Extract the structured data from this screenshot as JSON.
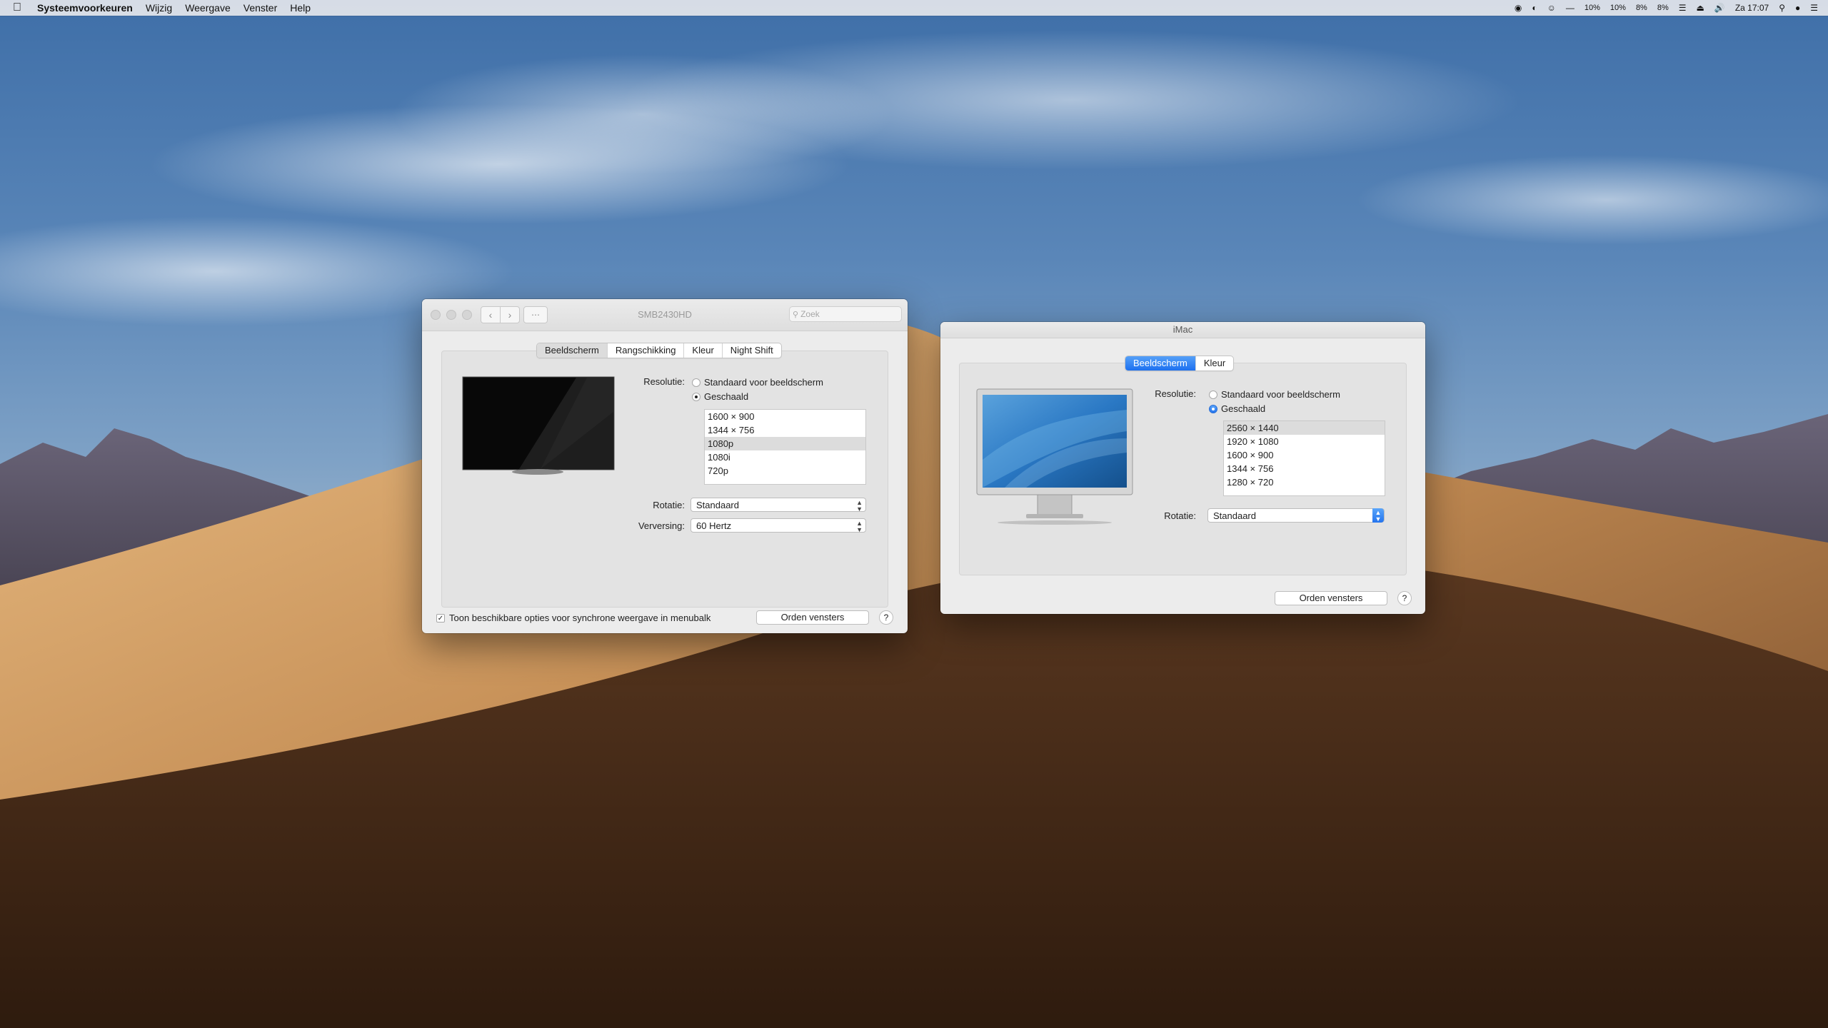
{
  "menubar": {
    "apple_icon": "apple-logo-icon",
    "app_name": "Systeemvoorkeuren",
    "menus": [
      "Wijzig",
      "Weergave",
      "Venster",
      "Help"
    ],
    "status": {
      "stat_1": "10%",
      "stat_2": "10%",
      "stat_3": "8%",
      "stat_4": "8%",
      "clock": "Za 17:07"
    }
  },
  "external_display_window": {
    "title": "SMB2430HD",
    "search_placeholder": "Zoek",
    "tabs": [
      "Beeldscherm",
      "Rangschikking",
      "Kleur",
      "Night Shift"
    ],
    "selected_tab": "Beeldscherm",
    "resolution_label": "Resolutie:",
    "radio_default": "Standaard voor beeldscherm",
    "radio_scaled": "Geschaald",
    "selected_radio": "Geschaald",
    "resolutions": [
      "1600 × 900",
      "1344 × 756",
      "1080p",
      "1080i",
      "720p"
    ],
    "selected_resolution": "1080p",
    "rotation_label": "Rotatie:",
    "rotation_value": "Standaard",
    "refresh_label": "Verversing:",
    "refresh_value": "60 Hertz",
    "mirror_checkbox_label": "Toon beschikbare opties voor synchrone weergave in menubalk",
    "mirror_checked": true,
    "gather_button": "Orden vensters",
    "help_button": "?"
  },
  "imac_window": {
    "title": "iMac",
    "tabs": [
      "Beeldscherm",
      "Kleur"
    ],
    "selected_tab": "Beeldscherm",
    "resolution_label": "Resolutie:",
    "radio_default": "Standaard voor beeldscherm",
    "radio_scaled": "Geschaald",
    "selected_radio": "Geschaald",
    "resolutions": [
      "2560 × 1440",
      "1920 × 1080",
      "1600 × 900",
      "1344 × 756",
      "1280 × 720"
    ],
    "selected_resolution": "2560 × 1440",
    "rotation_label": "Rotatie:",
    "rotation_value": "Standaard",
    "gather_button": "Orden vensters",
    "help_button": "?"
  },
  "colors": {
    "accent_blue": "#1d70f0",
    "window_bg": "#ececec",
    "panel_bg": "#e3e3e3"
  }
}
